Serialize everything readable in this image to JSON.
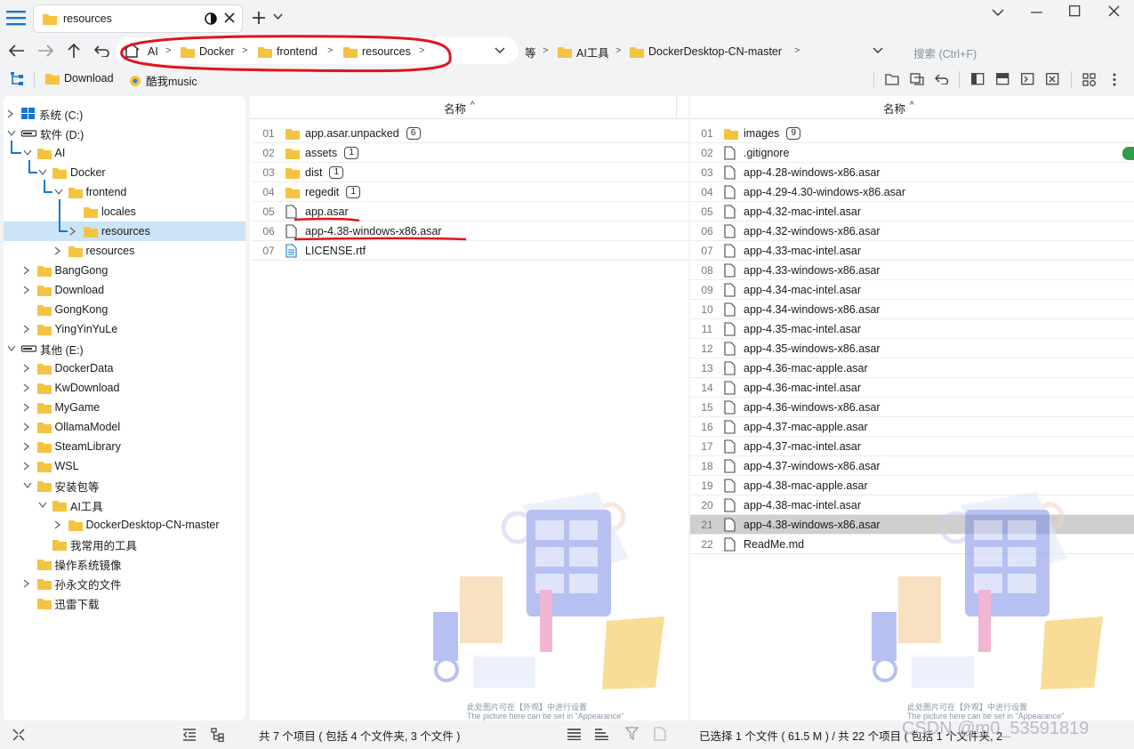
{
  "app": {
    "menu_icon": "hamburger-icon",
    "active_tab": {
      "label": "resources"
    },
    "add_tab_icon": "plus-icon"
  },
  "window_controls": [
    "chevron-down-icon",
    "minimize-icon",
    "maximize-icon",
    "close-icon"
  ],
  "breadcrumb_left": [
    "AI",
    "Docker",
    "frontend",
    "resources"
  ],
  "breadcrumb_right": [
    "等",
    "AI工具",
    "DockerDesktop-CN-master"
  ],
  "search": {
    "placeholder": "搜索 (Ctrl+F)"
  },
  "bookmarks": [
    {
      "label": "Download",
      "icon": "folder-icon"
    },
    {
      "label": "酷我music",
      "icon": "music-icon"
    }
  ],
  "tree": [
    {
      "label": "系统 (C:)",
      "icon": "drive-icon",
      "depth": 0,
      "chev": "right"
    },
    {
      "label": "软件 (D:)",
      "icon": "drive-icon",
      "depth": 0,
      "chev": "down"
    },
    {
      "label": "AI",
      "icon": "folder-icon",
      "depth": 1,
      "chev": "down"
    },
    {
      "label": "Docker",
      "icon": "folder-icon",
      "depth": 2,
      "chev": "down"
    },
    {
      "label": "frontend",
      "icon": "folder-icon",
      "depth": 3,
      "chev": "down"
    },
    {
      "label": "locales",
      "icon": "folder-icon",
      "depth": 4,
      "chev": ""
    },
    {
      "label": "resources",
      "icon": "folder-icon",
      "depth": 4,
      "chev": "right",
      "selected": true
    },
    {
      "label": "resources",
      "icon": "folder-icon",
      "depth": 3,
      "chev": "right"
    },
    {
      "label": "BangGong",
      "icon": "folder-icon",
      "depth": 1,
      "chev": "right"
    },
    {
      "label": "Download",
      "icon": "folder-icon",
      "depth": 1,
      "chev": "right"
    },
    {
      "label": "GongKong",
      "icon": "folder-icon",
      "depth": 1,
      "chev": ""
    },
    {
      "label": "YingYinYuLe",
      "icon": "folder-icon",
      "depth": 1,
      "chev": "right"
    },
    {
      "label": "其他 (E:)",
      "icon": "drive-icon",
      "depth": 0,
      "chev": "down"
    },
    {
      "label": "DockerData",
      "icon": "folder-icon",
      "depth": 1,
      "chev": "right"
    },
    {
      "label": "KwDownload",
      "icon": "folder-icon",
      "depth": 1,
      "chev": "right"
    },
    {
      "label": "MyGame",
      "icon": "folder-icon",
      "depth": 1,
      "chev": "right"
    },
    {
      "label": "OllamaModel",
      "icon": "folder-icon",
      "depth": 1,
      "chev": "right"
    },
    {
      "label": "SteamLibrary",
      "icon": "folder-icon",
      "depth": 1,
      "chev": "right"
    },
    {
      "label": "WSL",
      "icon": "folder-icon",
      "depth": 1,
      "chev": "right"
    },
    {
      "label": "安装包等",
      "icon": "folder-icon",
      "depth": 1,
      "chev": "down"
    },
    {
      "label": "AI工具",
      "icon": "folder-icon",
      "depth": 2,
      "chev": "down"
    },
    {
      "label": "DockerDesktop-CN-master",
      "icon": "folder-icon",
      "depth": 3,
      "chev": "right"
    },
    {
      "label": "我常用的工具",
      "icon": "folder-icon",
      "depth": 2,
      "chev": ""
    },
    {
      "label": "操作系统镜像",
      "icon": "folder-icon",
      "depth": 1,
      "chev": ""
    },
    {
      "label": "孙永文的文件",
      "icon": "folder-icon",
      "depth": 1,
      "chev": "right"
    },
    {
      "label": "迅雷下载",
      "icon": "folder-icon",
      "depth": 1,
      "chev": ""
    }
  ],
  "left_list": {
    "column_header": "名称",
    "rows": [
      {
        "idx": "01",
        "name": "app.asar.unpacked",
        "type": "folder",
        "count": "6"
      },
      {
        "idx": "02",
        "name": "assets",
        "type": "folder",
        "count": "1"
      },
      {
        "idx": "03",
        "name": "dist",
        "type": "folder",
        "count": "1"
      },
      {
        "idx": "04",
        "name": "regedit",
        "type": "folder",
        "count": "1"
      },
      {
        "idx": "05",
        "name": "app.asar",
        "type": "file",
        "count": ""
      },
      {
        "idx": "06",
        "name": "app-4.38-windows-x86.asar",
        "type": "file",
        "count": ""
      },
      {
        "idx": "07",
        "name": "LICENSE.rtf",
        "type": "rtf",
        "count": ""
      }
    ],
    "watermark_line1": "此处图片可在【外观】中进行设置",
    "watermark_line2": "The picture here can be set in \"Appearance\"",
    "status": "共 7 个项目 ( 包括 4 个文件夹, 3 个文件 )"
  },
  "right_list": {
    "column_header": "名称",
    "rows": [
      {
        "idx": "01",
        "name": "images",
        "type": "folder",
        "count": "9"
      },
      {
        "idx": "02",
        "name": ".gitignore",
        "type": "file",
        "count": ""
      },
      {
        "idx": "03",
        "name": "app-4.28-windows-x86.asar",
        "type": "file",
        "count": ""
      },
      {
        "idx": "04",
        "name": "app-4.29-4.30-windows-x86.asar",
        "type": "file",
        "count": ""
      },
      {
        "idx": "05",
        "name": "app-4.32-mac-intel.asar",
        "type": "file",
        "count": ""
      },
      {
        "idx": "06",
        "name": "app-4.32-windows-x86.asar",
        "type": "file",
        "count": ""
      },
      {
        "idx": "07",
        "name": "app-4.33-mac-intel.asar",
        "type": "file",
        "count": ""
      },
      {
        "idx": "08",
        "name": "app-4.33-windows-x86.asar",
        "type": "file",
        "count": ""
      },
      {
        "idx": "09",
        "name": "app-4.34-mac-intel.asar",
        "type": "file",
        "count": ""
      },
      {
        "idx": "10",
        "name": "app-4.34-windows-x86.asar",
        "type": "file",
        "count": ""
      },
      {
        "idx": "11",
        "name": "app-4.35-mac-intel.asar",
        "type": "file",
        "count": ""
      },
      {
        "idx": "12",
        "name": "app-4.35-windows-x86.asar",
        "type": "file",
        "count": ""
      },
      {
        "idx": "13",
        "name": "app-4.36-mac-apple.asar",
        "type": "file",
        "count": ""
      },
      {
        "idx": "14",
        "name": "app-4.36-mac-intel.asar",
        "type": "file",
        "count": ""
      },
      {
        "idx": "15",
        "name": "app-4.36-windows-x86.asar",
        "type": "file",
        "count": ""
      },
      {
        "idx": "16",
        "name": "app-4.37-mac-apple.asar",
        "type": "file",
        "count": ""
      },
      {
        "idx": "17",
        "name": "app-4.37-mac-intel.asar",
        "type": "file",
        "count": ""
      },
      {
        "idx": "18",
        "name": "app-4.37-windows-x86.asar",
        "type": "file",
        "count": ""
      },
      {
        "idx": "19",
        "name": "app-4.38-mac-apple.asar",
        "type": "file",
        "count": ""
      },
      {
        "idx": "20",
        "name": "app-4.38-mac-intel.asar",
        "type": "file",
        "count": ""
      },
      {
        "idx": "21",
        "name": "app-4.38-windows-x86.asar",
        "type": "file",
        "count": "",
        "selected": true
      },
      {
        "idx": "22",
        "name": "ReadMe.md",
        "type": "file",
        "count": ""
      }
    ],
    "watermark_line1": "此处图片可在【外观】中进行设置",
    "watermark_line2": "The picture here can be set in \"Appearance\"",
    "status": "已选择 1 个文件 ( 61.5 M ) / 共 22 个项目 ( 包括 1 个文件夹, 2",
    "csdn_watermark": "CSDN @m0_53591819"
  },
  "colors": {
    "accent": "#1677d2",
    "folder": "#f5c342",
    "selected_row": "#cfcfcf",
    "tree_selected": "#cce4f7",
    "annotation": "#e0141e"
  }
}
